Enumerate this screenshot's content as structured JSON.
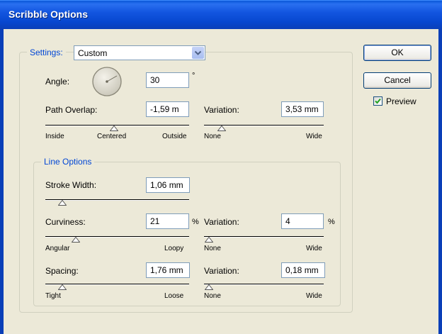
{
  "window": {
    "title": "Scribble Options"
  },
  "settings": {
    "legend_label": "Settings:",
    "preset_value": "Custom"
  },
  "buttons": {
    "ok": "OK",
    "cancel": "Cancel"
  },
  "preview": {
    "label": "Preview",
    "checked": true
  },
  "angle": {
    "label": "Angle:",
    "value": "30",
    "unit": "°"
  },
  "path_overlap": {
    "label": "Path Overlap:",
    "value": "-1,59 m",
    "ticks": [
      "Inside",
      "Centered",
      "Outside"
    ],
    "slider_position": 0.48
  },
  "path_overlap_variation": {
    "label": "Variation:",
    "value": "3,53 mm",
    "ticks": [
      "None",
      "Wide"
    ],
    "slider_position": 0.15
  },
  "line_options": {
    "legend": "Line Options",
    "stroke_width": {
      "label": "Stroke Width:",
      "value": "1,06 mm",
      "slider_position": 0.12
    },
    "curviness": {
      "label": "Curviness:",
      "value": "21",
      "unit": "%",
      "ticks": [
        "Angular",
        "Loopy"
      ],
      "slider_position": 0.21
    },
    "curviness_variation": {
      "label": "Variation:",
      "value": "4",
      "unit": "%",
      "ticks": [
        "None",
        "Wide"
      ],
      "slider_position": 0.04
    },
    "spacing": {
      "label": "Spacing:",
      "value": "1,76 mm",
      "ticks": [
        "Tight",
        "Loose"
      ],
      "slider_position": 0.12
    },
    "spacing_variation": {
      "label": "Variation:",
      "value": "0,18 mm",
      "ticks": [
        "None",
        "Wide"
      ],
      "slider_position": 0.04
    }
  },
  "icons": [
    "dropdown-arrow-icon",
    "checkmark-icon",
    "angle-dial-icon",
    "slider-thumb-icon"
  ]
}
